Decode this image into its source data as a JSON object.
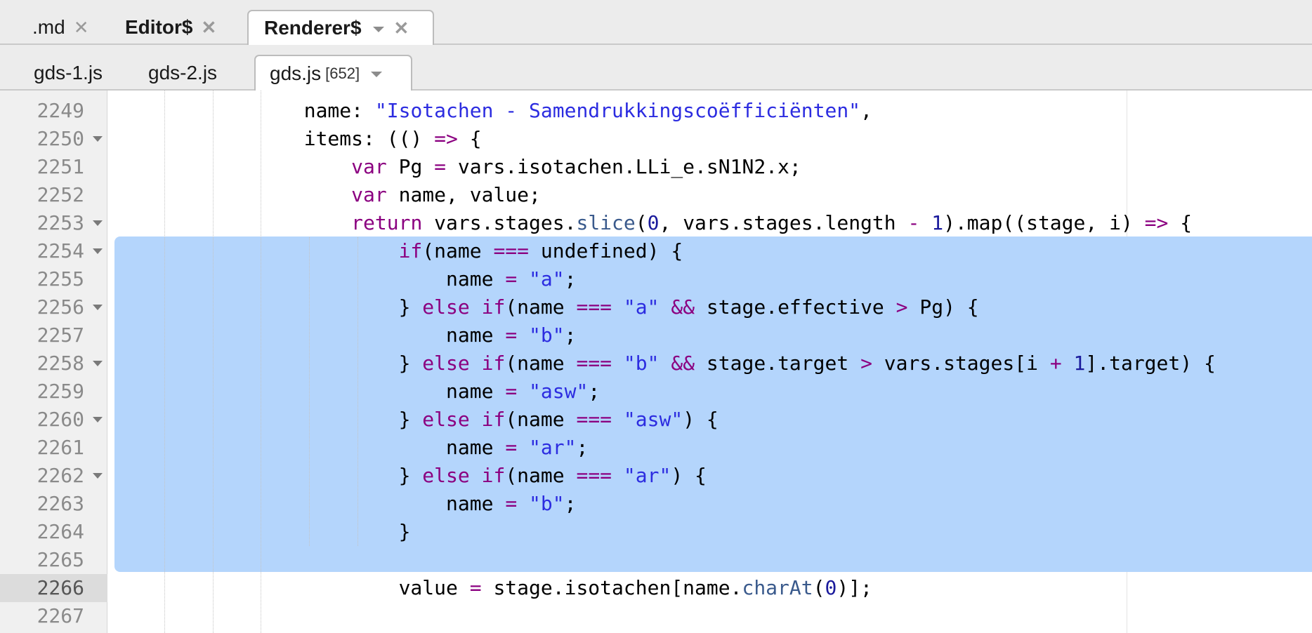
{
  "top_tabs": [
    {
      "label": ".md",
      "active": false
    },
    {
      "label": "Editor$",
      "active": false
    },
    {
      "label": "Renderer$",
      "active": true
    }
  ],
  "file_tabs": [
    {
      "label": "gds-1.js",
      "active": false
    },
    {
      "label": "gds-2.js",
      "active": false
    },
    {
      "label": "gds.js",
      "count": "[652]",
      "active": true
    }
  ],
  "icons": {
    "close": "close-icon",
    "dropdown": "chevron-down-icon",
    "fold": "fold-arrow-icon"
  },
  "colors": {
    "keyword": "#8b0080",
    "string": "#2c2ce0",
    "number": "#1a1a9c",
    "selection": "#b4d5fc",
    "gutter": "#f0f0f0"
  },
  "editor": {
    "current_line": "2266",
    "lines": [
      {
        "n": "2249",
        "fold": false,
        "tokens": [
          {
            "t": "                "
          },
          {
            "t": "name: "
          },
          {
            "t": "\"Isotachen - Samendrukkingscoëfficiënten\"",
            "c": "str"
          },
          {
            "t": ","
          }
        ]
      },
      {
        "n": "2250",
        "fold": true,
        "tokens": [
          {
            "t": "                "
          },
          {
            "t": "items: (() "
          },
          {
            "t": "=>",
            "c": "op"
          },
          {
            "t": " {"
          }
        ]
      },
      {
        "n": "2251",
        "fold": false,
        "tokens": [
          {
            "t": "                    "
          },
          {
            "t": "var",
            "c": "kw"
          },
          {
            "t": " Pg "
          },
          {
            "t": "=",
            "c": "op"
          },
          {
            "t": " vars.isotachen.LLi_e.sN1N2.x;"
          }
        ]
      },
      {
        "n": "2252",
        "fold": false,
        "tokens": [
          {
            "t": "                    "
          },
          {
            "t": "var",
            "c": "kw"
          },
          {
            "t": " name, value;"
          }
        ]
      },
      {
        "n": "2253",
        "fold": true,
        "tokens": [
          {
            "t": "                    "
          },
          {
            "t": "return",
            "c": "kw"
          },
          {
            "t": " vars.stages."
          },
          {
            "t": "slice",
            "c": "fn"
          },
          {
            "t": "("
          },
          {
            "t": "0",
            "c": "num"
          },
          {
            "t": ", vars.stages.length "
          },
          {
            "t": "-",
            "c": "op"
          },
          {
            "t": " "
          },
          {
            "t": "1",
            "c": "num"
          },
          {
            "t": ").map((stage, i) "
          },
          {
            "t": "=>",
            "c": "op"
          },
          {
            "t": " {"
          }
        ]
      },
      {
        "n": "2254",
        "fold": true,
        "tokens": [
          {
            "t": "                        "
          },
          {
            "t": "if",
            "c": "kw"
          },
          {
            "t": "(name "
          },
          {
            "t": "===",
            "c": "op"
          },
          {
            "t": " undefined) {"
          }
        ]
      },
      {
        "n": "2255",
        "fold": false,
        "tokens": [
          {
            "t": "                            "
          },
          {
            "t": "name "
          },
          {
            "t": "=",
            "c": "op"
          },
          {
            "t": " "
          },
          {
            "t": "\"a\"",
            "c": "str"
          },
          {
            "t": ";"
          }
        ]
      },
      {
        "n": "2256",
        "fold": true,
        "tokens": [
          {
            "t": "                        "
          },
          {
            "t": "} "
          },
          {
            "t": "else if",
            "c": "kw"
          },
          {
            "t": "(name "
          },
          {
            "t": "===",
            "c": "op"
          },
          {
            "t": " "
          },
          {
            "t": "\"a\"",
            "c": "str"
          },
          {
            "t": " "
          },
          {
            "t": "&&",
            "c": "op"
          },
          {
            "t": " stage.effective "
          },
          {
            "t": ">",
            "c": "op"
          },
          {
            "t": " Pg) {"
          }
        ]
      },
      {
        "n": "2257",
        "fold": false,
        "tokens": [
          {
            "t": "                            "
          },
          {
            "t": "name "
          },
          {
            "t": "=",
            "c": "op"
          },
          {
            "t": " "
          },
          {
            "t": "\"b\"",
            "c": "str"
          },
          {
            "t": ";"
          }
        ]
      },
      {
        "n": "2258",
        "fold": true,
        "tokens": [
          {
            "t": "                        "
          },
          {
            "t": "} "
          },
          {
            "t": "else if",
            "c": "kw"
          },
          {
            "t": "(name "
          },
          {
            "t": "===",
            "c": "op"
          },
          {
            "t": " "
          },
          {
            "t": "\"b\"",
            "c": "str"
          },
          {
            "t": " "
          },
          {
            "t": "&&",
            "c": "op"
          },
          {
            "t": " stage.target "
          },
          {
            "t": ">",
            "c": "op"
          },
          {
            "t": " vars.stages[i "
          },
          {
            "t": "+",
            "c": "op"
          },
          {
            "t": " "
          },
          {
            "t": "1",
            "c": "num"
          },
          {
            "t": "].target) {"
          }
        ]
      },
      {
        "n": "2259",
        "fold": false,
        "tokens": [
          {
            "t": "                            "
          },
          {
            "t": "name "
          },
          {
            "t": "=",
            "c": "op"
          },
          {
            "t": " "
          },
          {
            "t": "\"asw\"",
            "c": "str"
          },
          {
            "t": ";"
          }
        ]
      },
      {
        "n": "2260",
        "fold": true,
        "tokens": [
          {
            "t": "                        "
          },
          {
            "t": "} "
          },
          {
            "t": "else if",
            "c": "kw"
          },
          {
            "t": "(name "
          },
          {
            "t": "===",
            "c": "op"
          },
          {
            "t": " "
          },
          {
            "t": "\"asw\"",
            "c": "str"
          },
          {
            "t": ") {"
          }
        ]
      },
      {
        "n": "2261",
        "fold": false,
        "tokens": [
          {
            "t": "                            "
          },
          {
            "t": "name "
          },
          {
            "t": "=",
            "c": "op"
          },
          {
            "t": " "
          },
          {
            "t": "\"ar\"",
            "c": "str"
          },
          {
            "t": ";"
          }
        ]
      },
      {
        "n": "2262",
        "fold": true,
        "tokens": [
          {
            "t": "                        "
          },
          {
            "t": "} "
          },
          {
            "t": "else if",
            "c": "kw"
          },
          {
            "t": "(name "
          },
          {
            "t": "===",
            "c": "op"
          },
          {
            "t": " "
          },
          {
            "t": "\"ar\"",
            "c": "str"
          },
          {
            "t": ") {"
          }
        ]
      },
      {
        "n": "2263",
        "fold": false,
        "tokens": [
          {
            "t": "                            "
          },
          {
            "t": "name "
          },
          {
            "t": "=",
            "c": "op"
          },
          {
            "t": " "
          },
          {
            "t": "\"b\"",
            "c": "str"
          },
          {
            "t": ";"
          }
        ]
      },
      {
        "n": "2264",
        "fold": false,
        "tokens": [
          {
            "t": "                        "
          },
          {
            "t": "}"
          }
        ]
      },
      {
        "n": "2265",
        "fold": false,
        "tokens": []
      },
      {
        "n": "2266",
        "fold": false,
        "tokens": [
          {
            "t": "                        "
          },
          {
            "t": "value "
          },
          {
            "t": "=",
            "c": "op"
          },
          {
            "t": " stage.isotachen[name."
          },
          {
            "t": "charAt",
            "c": "fn"
          },
          {
            "t": "("
          },
          {
            "t": "0",
            "c": "num"
          },
          {
            "t": ")];"
          }
        ]
      },
      {
        "n": "2267",
        "fold": false,
        "tokens": []
      }
    ]
  }
}
